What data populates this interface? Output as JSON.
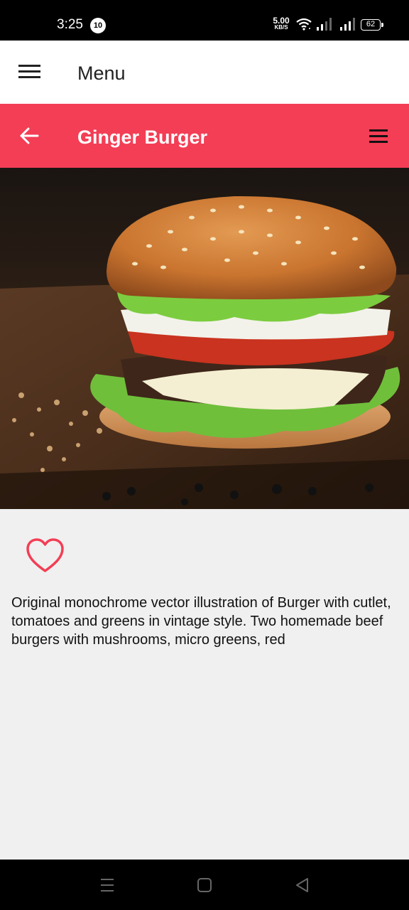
{
  "status_bar": {
    "time": "3:25",
    "notification_count": "10",
    "net_speed_value": "5.00",
    "net_speed_unit": "KB/S",
    "battery": "62"
  },
  "top_bar": {
    "title": "Menu"
  },
  "detail_header": {
    "title": "Ginger Burger",
    "color": "#f33e55"
  },
  "item": {
    "image_alt": "burger photo",
    "description": "Original monochrome vector illustration of Burger with cutlet, tomatoes and greens in vintage style. Two homemade beef burgers with mushrooms, micro greens, red"
  },
  "icons": {
    "top_menu": "menu-icon",
    "back": "back-arrow-icon",
    "header_menu": "hamburger-icon",
    "favorite": "heart-outline-icon",
    "nav_recent": "recent-apps-icon",
    "nav_home": "home-icon",
    "nav_back": "back-triangle-icon"
  }
}
